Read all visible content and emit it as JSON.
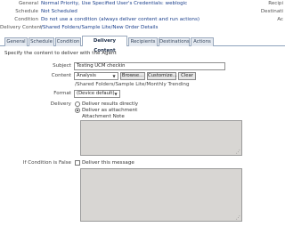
{
  "summary": {
    "general_label": "General",
    "general_value": "Normal Priority, Use Specified User's Credentials: weblogic",
    "schedule_label": "Schedule",
    "schedule_value": "Not Scheduled",
    "condition_label": "Condition",
    "condition_value": "Do not use a condition (always deliver content and run actions)",
    "delivery_label": "Delivery Content",
    "delivery_value": "/Shared Folders/Sample Lite/New Order Details",
    "right_labels": [
      "Recipi",
      "Destinati",
      "Ac"
    ]
  },
  "tabs": [
    {
      "label": "General",
      "active": false
    },
    {
      "label": "Schedule",
      "active": false
    },
    {
      "label": "Condition",
      "active": false
    },
    {
      "label": "Delivery Content",
      "active": true
    },
    {
      "label": "Recipients",
      "active": false
    },
    {
      "label": "Destinations",
      "active": false
    },
    {
      "label": "Actions",
      "active": false
    }
  ],
  "form": {
    "intro": "Specify the content to deliver with the Agent",
    "subject_label": "Subject",
    "subject_value": "Testing UCM checkin",
    "content_label": "Content",
    "content_value": "Analysis",
    "browse_label": "Browse...",
    "customize_label": "Customize...",
    "clear_label": "Clear",
    "content_path": "/Shared Folders/Sample Lite/Monthly Trending",
    "format_label": "Format",
    "format_value": "(Device default)",
    "delivery_label": "Delivery",
    "option_direct": "Deliver results directly",
    "option_attachment": "Deliver as attachment",
    "attachment_note_label": "Attachment Note",
    "condition_false_label": "If Condition is False",
    "deliver_message_label": "Deliver this message"
  }
}
